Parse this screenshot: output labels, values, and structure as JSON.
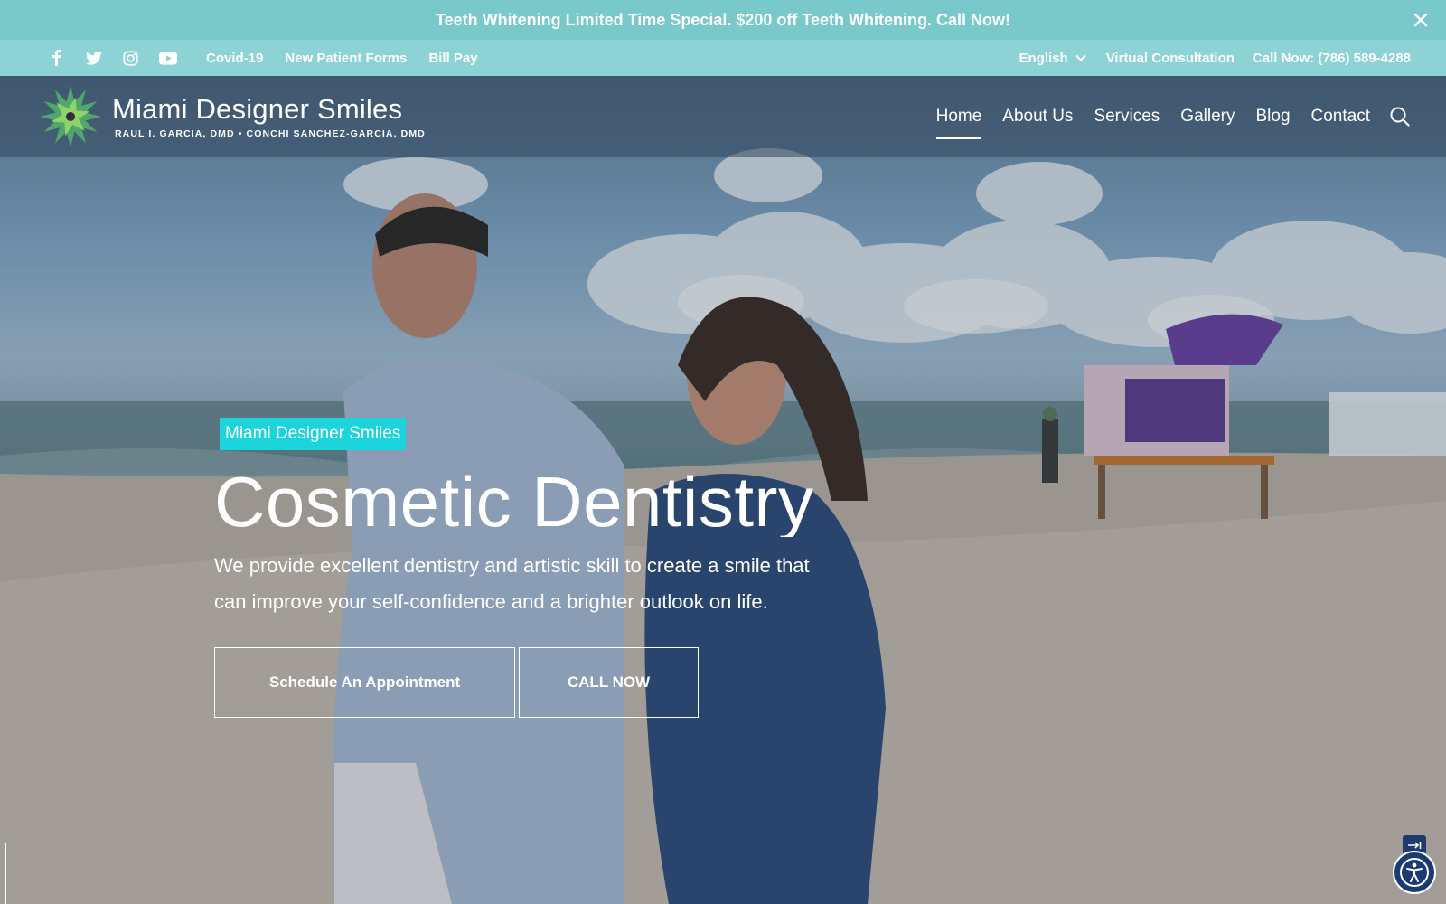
{
  "announcement": {
    "text": "Teeth Whitening Limited Time Special. $200 off Teeth Whitening. Call Now!",
    "close_icon": "close-icon"
  },
  "utility_bar": {
    "social": [
      "facebook-icon",
      "twitter-icon",
      "instagram-icon",
      "youtube-icon"
    ],
    "links": [
      "Covid-19",
      "New Patient Forms",
      "Bill Pay"
    ],
    "language": "English",
    "virtual_consultation": "Virtual Consultation",
    "call": "Call Now: (786) 589-4288"
  },
  "nav": {
    "logo_name": "Miami Designer Smiles",
    "logo_subtitle": "RAUL I. GARCIA, DMD • CONCHI SANCHEZ-GARCIA, DMD",
    "items": [
      "Home",
      "About Us",
      "Services",
      "Gallery",
      "Blog",
      "Contact"
    ],
    "active": "Home",
    "search_icon": "search-icon"
  },
  "hero": {
    "tagline": "Miami Designer Smiles",
    "headline": "Cosmetic Dentistry",
    "description": "We provide excellent dentistry and artistic skill to create a smile that can improve your self-confidence and a brighter outlook on life.",
    "cta_schedule": "Schedule An Appointment",
    "cta_call": "CALL NOW"
  },
  "colors": {
    "announcement_bg": "#79c9cb",
    "utility_bg": "#8dd3d6",
    "tagline_bg": "#1ed4dc",
    "accessibility_bg": "#1b3a72"
  },
  "widgets": {
    "accessibility_icon": "accessibility-icon",
    "skip_icon": "skip-arrow-icon"
  }
}
